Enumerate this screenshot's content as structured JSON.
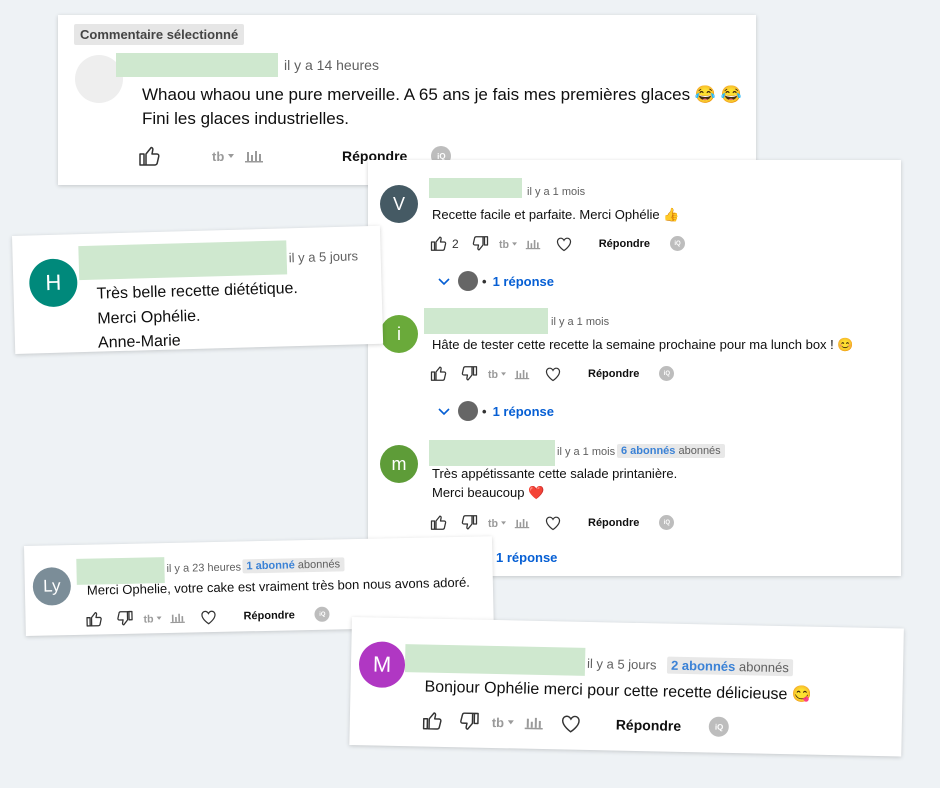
{
  "card1": {
    "tag": "Commentaire sélectionné",
    "time": "il y a 14 heures",
    "line1": "Whaou whaou une pure merveille. A 65 ans je fais mes premières glaces 😂 😂",
    "line2": "Fini les glaces industrielles.",
    "reply": "Répondre"
  },
  "card2": {
    "avatar": "H",
    "avatar_color": "#00897b",
    "time": "il y a 5 jours",
    "line1": "Très belle recette diététique.",
    "line2": "Merci Ophélie.",
    "line3": "Anne-Marie"
  },
  "card3": {
    "c1": {
      "avatar": "V",
      "avatar_color": "#455a64",
      "time": "il y a 1 mois",
      "text": "Recette facile et parfaite. Merci Ophélie 👍",
      "likes": "2",
      "reply": "Répondre",
      "replies": "1 réponse"
    },
    "c2": {
      "avatar": "i",
      "avatar_color": "#6aaa3a",
      "time": "il y a 1 mois",
      "text": "Hâte de tester cette recette la semaine prochaine pour ma lunch box ! 😊",
      "reply": "Répondre",
      "replies": "1 réponse"
    },
    "c3": {
      "avatar": "m",
      "avatar_color": "#5e9c38",
      "time": "il y a 1 mois",
      "badge_count": "6 abonnés",
      "badge_word": "abonnés",
      "line1": "Très appétissante cette salade printanière.",
      "line2": "Merci beaucoup ❤️",
      "reply": "Répondre",
      "replies": "1 réponse"
    }
  },
  "card4": {
    "avatar": "Ly",
    "avatar_color": "#7b8d98",
    "time": "il y a 23 heures",
    "badge_count": "1 abonné",
    "badge_word": "abonnés",
    "text": "Merci Ophelie, votre cake est vraiment très bon nous avons adoré.",
    "reply": "Répondre"
  },
  "card5": {
    "avatar": "M",
    "avatar_color": "#b037c3",
    "time": "il y a 5 jours",
    "badge_count": "2 abonnés",
    "badge_word": "abonnés",
    "text": "Bonjour Ophélie merci pour cette recette délicieuse 😋",
    "reply": "Répondre"
  },
  "icons": [
    "like-icon",
    "dislike-icon",
    "translate-icon",
    "stats-icon",
    "heart-icon",
    "chevron-down-icon"
  ],
  "mini_badge": "iQ"
}
